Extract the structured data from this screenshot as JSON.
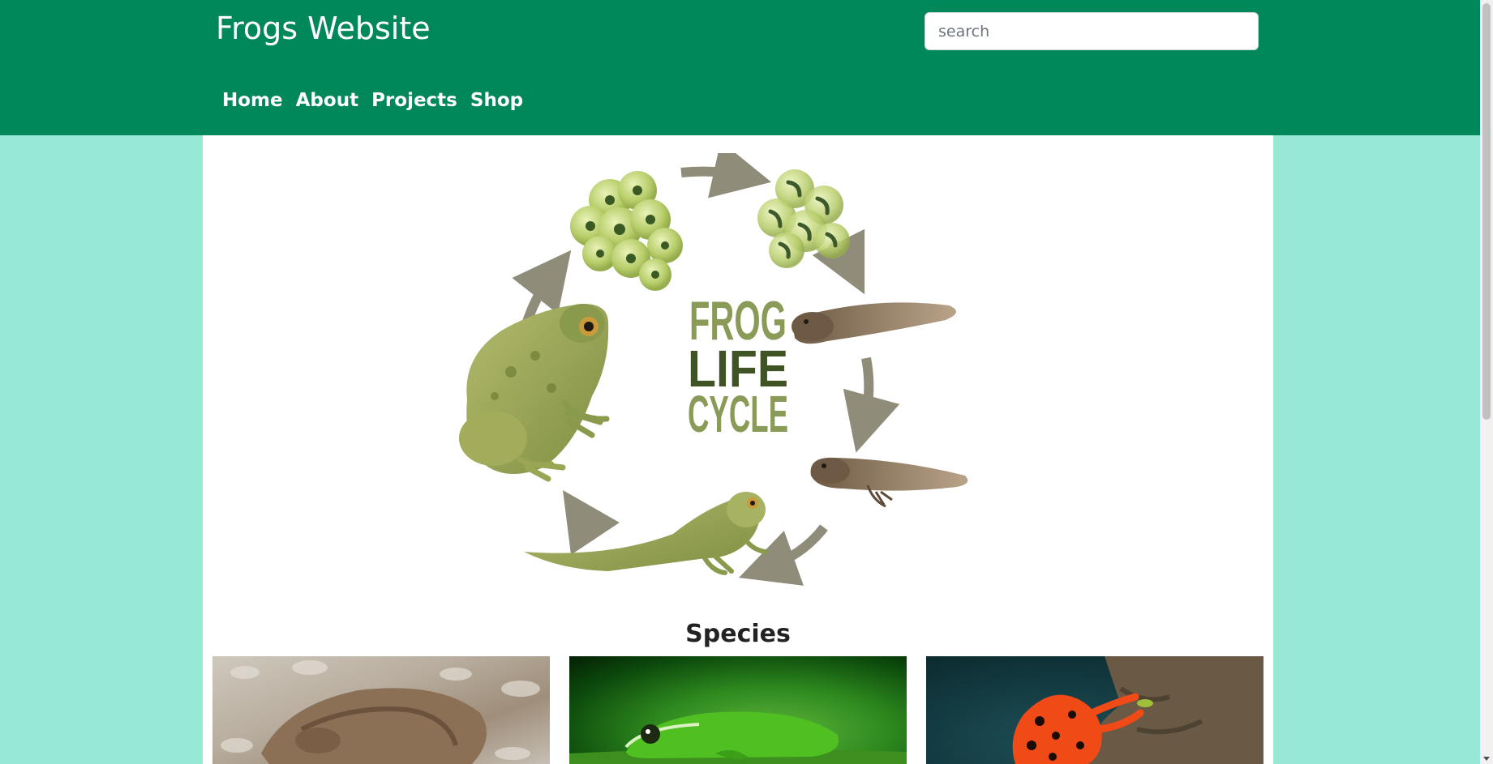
{
  "header": {
    "title": "Frogs Website",
    "search_placeholder": "search"
  },
  "nav": {
    "items": [
      {
        "label": "Home"
      },
      {
        "label": "About"
      },
      {
        "label": "Projects"
      },
      {
        "label": "Shop"
      }
    ]
  },
  "lifecycle": {
    "line1": "FROG",
    "line2": "LIFE",
    "line3": "CYCLE"
  },
  "species": {
    "heading": "Species",
    "cards": [
      {
        "icon": "brown-frog-photo"
      },
      {
        "icon": "green-tree-frog-photo"
      },
      {
        "icon": "red-poison-dart-frog-photo"
      }
    ]
  },
  "colors": {
    "header_bg": "#00875a",
    "page_bg": "#98e8d6",
    "content_bg": "#ffffff",
    "arrow": "#8f8c7a",
    "frog_green": "#8a9a4c",
    "text_dark_green": "#3f5325"
  }
}
